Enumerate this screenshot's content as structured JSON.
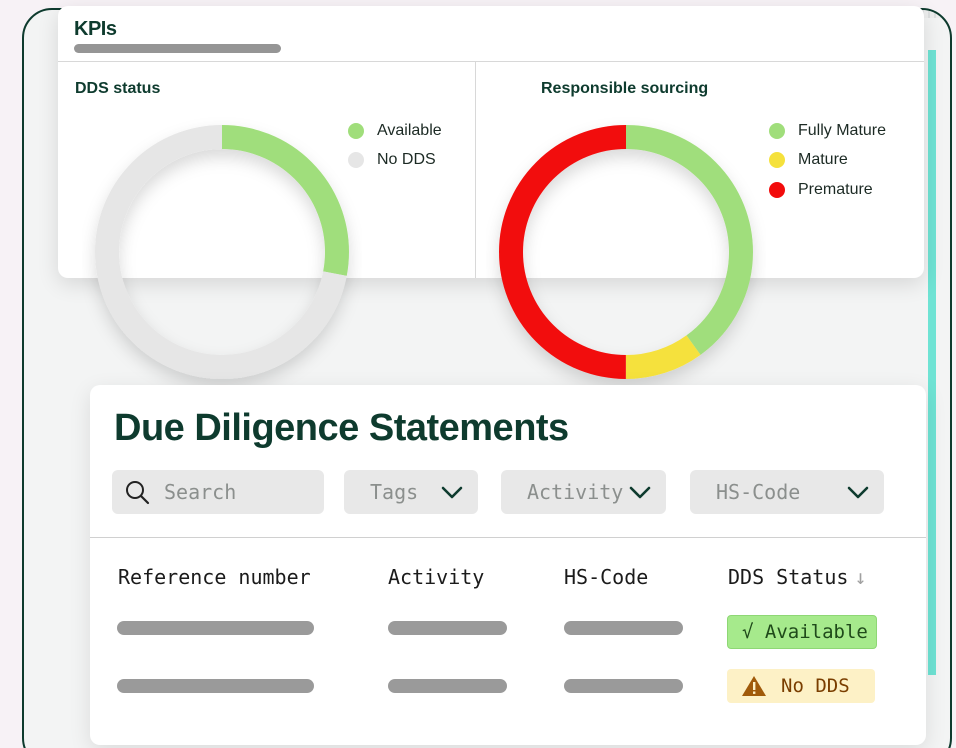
{
  "kpis": {
    "title": "KPIs",
    "dds_status": {
      "title": "DDS status",
      "legend": [
        {
          "label": "Available",
          "color": "#a0de7b"
        },
        {
          "label": "No DDS",
          "color": "#e6e6e6"
        }
      ],
      "chart_data": {
        "type": "donut",
        "slices": [
          {
            "label": "Available",
            "value": 28,
            "color": "#a0de7b"
          },
          {
            "label": "No DDS",
            "value": 72,
            "color": "#e6e6e6"
          }
        ]
      }
    },
    "responsible_sourcing": {
      "title": "Responsible sourcing",
      "legend": [
        {
          "label": "Fully Mature",
          "color": "#a0de7b"
        },
        {
          "label": "Mature",
          "color": "#f5e13c"
        },
        {
          "label": "Premature",
          "color": "#f20c0c"
        }
      ],
      "chart_data": {
        "type": "donut",
        "slices": [
          {
            "label": "Fully Mature",
            "value": 40,
            "color": "#a0de7b"
          },
          {
            "label": "Mature",
            "value": 10,
            "color": "#f5e13c"
          },
          {
            "label": "Premature",
            "value": 50,
            "color": "#f20c0c"
          }
        ]
      }
    }
  },
  "dds": {
    "title": "Due Diligence Statements",
    "search_placeholder": "Search",
    "filters": [
      "Tags",
      "Activity",
      "HS-Code"
    ],
    "columns": [
      "Reference number",
      "Activity",
      "HS-Code",
      "DDS Status"
    ],
    "sort_indicator": "↓",
    "rows": [
      {
        "status": "Available",
        "status_icon": "√",
        "status_color": "#a6ea8c"
      },
      {
        "status": "No DDS",
        "status_icon": "warning-icon",
        "status_color": "#fdf1c6"
      }
    ]
  }
}
